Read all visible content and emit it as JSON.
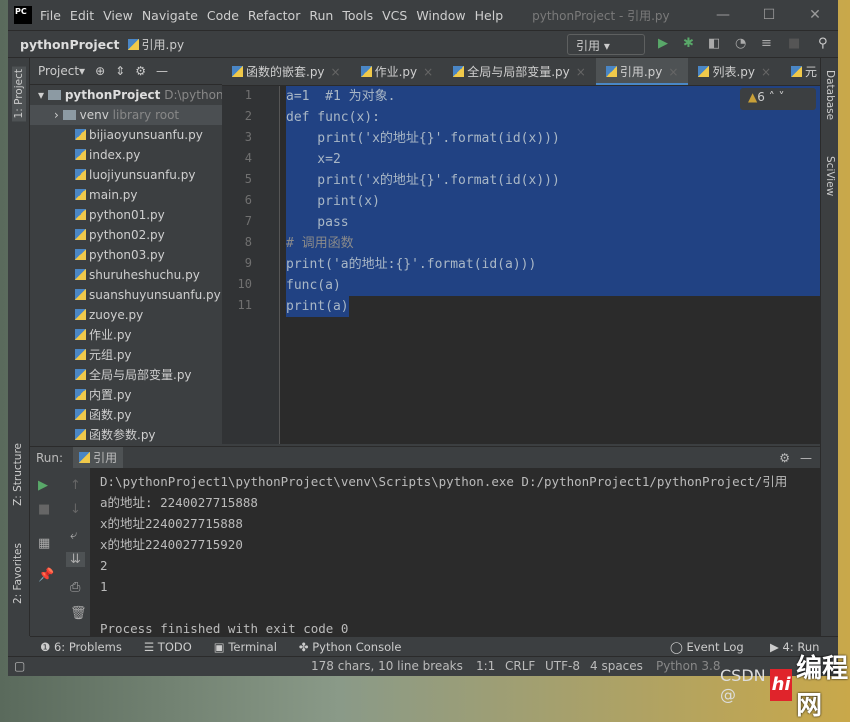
{
  "titlebar": {
    "logo": "PC",
    "menu": [
      "File",
      "Edit",
      "View",
      "Navigate",
      "Code",
      "Refactor",
      "Run",
      "Tools",
      "VCS",
      "Window",
      "Help"
    ],
    "title": "pythonProject - 引用.py"
  },
  "navbar": {
    "project": "pythonProject",
    "file": "引用.py",
    "run_config": "引用 ▾"
  },
  "project_panel": {
    "title": "Project▾",
    "root": "pythonProject",
    "root_path": "D:\\python",
    "venv": "venv",
    "venv_note": "library root",
    "files": [
      "bijiaoyunsuanfu.py",
      "index.py",
      "luojiyunsuanfu.py",
      "main.py",
      "python01.py",
      "python02.py",
      "python03.py",
      "shuruheshuchu.py",
      "suanshuyunsuanfu.py",
      "zuoye.py",
      "作业.py",
      "元组.py",
      "全局与局部变量.py",
      "内置.py",
      "函数.py",
      "函数参数.py"
    ]
  },
  "tabs": [
    {
      "label": "函数的嵌套.py"
    },
    {
      "label": "作业.py"
    },
    {
      "label": "全局与局部变量.py"
    },
    {
      "label": "引用.py",
      "active": true
    },
    {
      "label": "列表.py"
    },
    {
      "label": "元"
    }
  ],
  "editor": {
    "warnings": "6",
    "lines": [
      "a=1  #1 为对象.",
      "def func(x):",
      "    print('x的地址{}'.format(id(x)))",
      "    x=2",
      "    print('x的地址{}'.format(id(x)))",
      "    print(x)",
      "    pass",
      "# 调用函数",
      "print('a的地址:{}'.format(id(a)))",
      "func(a)",
      "print(a)"
    ]
  },
  "run": {
    "label": "Run:",
    "tab": "引用",
    "output": [
      "D:\\pythonProject1\\pythonProject\\venv\\Scripts\\python.exe D:/pythonProject1/pythonProject/引用",
      "a的地址: 2240027715888",
      "x的地址2240027715888",
      "x的地址2240027715920",
      "2",
      "1",
      "",
      "Process finished with exit code 0"
    ]
  },
  "left_stripe": [
    "1: Project",
    "Z: Structure",
    "2: Favorites"
  ],
  "right_stripe": [
    "Database",
    "SciView"
  ],
  "bottom_tools": [
    "6: Problems",
    "TODO",
    "Terminal",
    "Python Console",
    "Event Log",
    "4: Run"
  ],
  "status": {
    "chars": "178 chars, 10 line breaks",
    "pos": "1:1",
    "eol": "CRLF",
    "enc": "UTF-8",
    "indent": "4 spaces",
    "interp": "Python 3.8"
  },
  "watermark": {
    "csdn": "CSDN @",
    "brand": "编程网",
    "logo": "hi"
  }
}
